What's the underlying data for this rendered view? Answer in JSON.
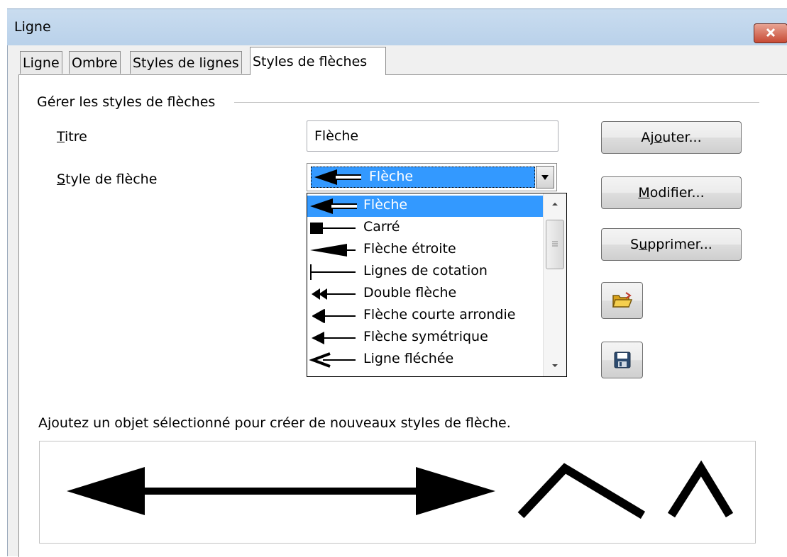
{
  "window": {
    "title": "Ligne"
  },
  "tabs": [
    {
      "label": "Ligne"
    },
    {
      "label": "Ombre"
    },
    {
      "label": "Styles de lignes"
    },
    {
      "label": "Styles de flèches"
    }
  ],
  "group": {
    "title": "Gérer les styles de flèches"
  },
  "form": {
    "titre": {
      "label_u": "T",
      "label_rest": "itre",
      "value": "Flèche"
    },
    "style": {
      "label_u": "S",
      "label_rest": "tyle de flèche",
      "selected": "Flèche"
    }
  },
  "list_items": [
    {
      "label": "Flèche",
      "icon": "arrow-fleche-icon"
    },
    {
      "label": "Carré",
      "icon": "arrow-square-icon"
    },
    {
      "label": "Flèche étroite",
      "icon": "arrow-narrow-icon"
    },
    {
      "label": "Lignes de cotation",
      "icon": "arrow-dimension-icon"
    },
    {
      "label": "Double flèche",
      "icon": "arrow-double-icon"
    },
    {
      "label": "Flèche courte arrondie",
      "icon": "arrow-short-rounded-icon"
    },
    {
      "label": "Flèche symétrique",
      "icon": "arrow-symmetric-icon"
    },
    {
      "label": "Ligne fléchée",
      "icon": "arrow-line-icon"
    }
  ],
  "buttons": {
    "ajouter": {
      "pre": "Aj",
      "u": "o",
      "post": "uter..."
    },
    "modifier": {
      "pre": "",
      "u": "M",
      "post": "odifier..."
    },
    "supprimer": {
      "pre": "S",
      "u": "u",
      "post": "pprimer..."
    },
    "load_icon": "open-folder-icon",
    "save_icon": "save-floppy-icon"
  },
  "hint": "Ajoutez un objet sélectionné pour créer de nouveaux styles de flèche.",
  "colors": {
    "selection": "#3399ff",
    "titlebar": "#b9d1ea",
    "close": "#c74a35"
  }
}
